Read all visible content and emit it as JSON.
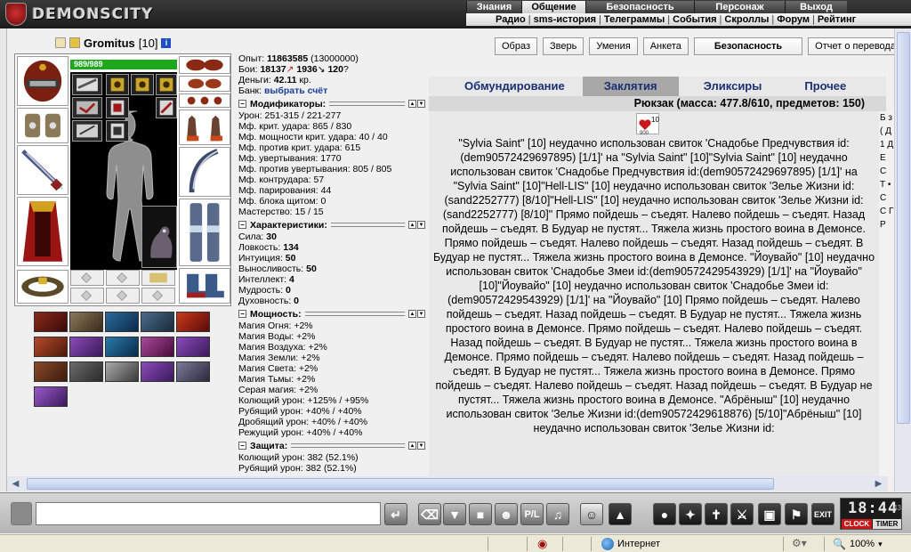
{
  "app": {
    "logo_text": "DEMONSCITY"
  },
  "top_menu": {
    "primary": [
      {
        "label": "Знания",
        "w": 62,
        "active": false
      },
      {
        "label": "Общение",
        "w": 72,
        "active": true
      },
      {
        "label": "Безопасность",
        "w": 122,
        "active": false
      },
      {
        "label": "Персонаж",
        "w": 102,
        "active": false
      },
      {
        "label": "Выход",
        "w": 70,
        "active": false
      }
    ],
    "secondary": [
      "Радио",
      "sms-история",
      "Телеграммы",
      "События",
      "Скроллы",
      "Форум",
      "Рейтинг"
    ]
  },
  "character": {
    "nickname": "Gromitus",
    "level": "[10]",
    "info_icon": "i",
    "hp": "989/989"
  },
  "stats": {
    "exp_label": "Опыт:",
    "exp_value": "11863585",
    "exp_next": "(13000000)",
    "battles_label": "Бои:",
    "battles_won": "18137",
    "battles_lost": "1936",
    "battles_draw": "120",
    "money_label": "Деньги:",
    "money_value": "42.11",
    "money_unit": "кр.",
    "bank_label": "Банк:",
    "bank_link": "выбрать счёт"
  },
  "sections": {
    "modifiers": {
      "title": "Модификаторы:",
      "rows": [
        "Урон: 251-315 / 221-277",
        "Мф. крит. удара: 865 / 830",
        "Мф. мощности крит. удара: 40 / 40",
        "Мф. против крит. удара: 615",
        "Мф. увертывания: 1770",
        "Мф. против увертывания: 805 / 805",
        "Мф. контрудара: 57",
        "Мф. парирования: 44",
        "Мф. блока щитом: 0",
        "Мастерство: 15 / 15"
      ]
    },
    "characteristics": {
      "title": "Характеристики:",
      "rows": [
        {
          "label": "Сила:",
          "value": "30"
        },
        {
          "label": "Ловкость:",
          "value": "134"
        },
        {
          "label": "Интуиция:",
          "value": "50"
        },
        {
          "label": "Выносливость:",
          "value": "50"
        },
        {
          "label": "Интеллект:",
          "value": "4"
        },
        {
          "label": "Мудрость:",
          "value": "0"
        },
        {
          "label": "Духовность:",
          "value": "0"
        }
      ]
    },
    "power": {
      "title": "Мощность:",
      "rows": [
        "Магия Огня: +2%",
        "Магия Воды: +2%",
        "Магия Воздуха: +2%",
        "Магия Земли: +2%",
        "Магия Света: +2%",
        "Магия Тьмы: +2%",
        "Серая магия: +2%",
        "Колющий урон: +125% / +95%",
        "Рубящий урон: +40% / +40%",
        "Дробящий урон: +40% / +40%",
        "Режущий урон: +40% / +40%"
      ]
    },
    "defense": {
      "title": "Защита:",
      "rows": [
        "Колющий урон: 382 (52.1%)",
        "Рубящий урон: 382 (52.1%)"
      ]
    }
  },
  "profile_buttons": [
    "Образ",
    "Зверь",
    "Умения",
    "Анкета",
    "Безопасность",
    "Отчет о переводах"
  ],
  "inventory": {
    "tabs": [
      {
        "label": "Обмундирование",
        "active": false
      },
      {
        "label": "Заклятия",
        "active": true
      },
      {
        "label": "Эликсиры",
        "active": false
      },
      {
        "label": "Прочее",
        "active": false
      }
    ],
    "backpack": "Рюкзак (масса: 477.8/610, предметов: 150)",
    "scroll_count": "10",
    "scroll_sub": "900",
    "log": "\"Sylvia Saint\" [10] неудачно использован свиток 'Снадобье Предчувствия id:(dem90572429697895) [1/1]' на \"Sylvia Saint\" [10]\"Sylvia Saint\" [10] неудачно использован свиток 'Снадобье Предчувствия id:(dem90572429697895) [1/1]' на \"Sylvia Saint\" [10]\"Hell-LIS\" [10] неудачно использован свиток 'Зелье Жизни id:(sand2252777) [8/10]\"Hell-LIS\" [10] неудачно использован свиток 'Зелье Жизни id:(sand2252777) [8/10]\" Прямо пойдешь – съедят. Налево пойдешь – съедят. Назад пойдешь – съедят. В Будуар не пустят... Тяжела жизнь простого воина в Демонсе. Прямо пойдешь – съедят. Налево пойдешь – съедят. Назад пойдешь – съедят. В Будуар не пустят... Тяжела жизнь простого воина в Демонсе. \"Йоувайо\" [10] неудачно использован свиток 'Снадобье Змеи id:(dem90572429543929) [1/1]' на \"Йоувайо\" [10]\"Йоувайо\" [10] неудачно использован свиток 'Снадобье Змеи id:(dem90572429543929) [1/1]' на \"Йоувайо\" [10] Прямо пойдешь – съедят. Налево пойдешь – съедят. Назад пойдешь – съедят. В Будуар не пустят... Тяжела жизнь простого воина в Демонсе. Прямо пойдешь – съедят. Налево пойдешь – съедят. Назад пойдешь – съедят. В Будуар не пустят... Тяжела жизнь простого воина в Демонсе. Прямо пойдешь – съедят. Налево пойдешь – съедят. Назад пойдешь – съедят. В Будуар не пустят... Тяжела жизнь простого воина в Демонсе. Прямо пойдешь – съедят. Налево пойдешь – съедят. Назад пойдешь – съедят. В Будуар не пустят... Тяжела жизнь простого воина в Демонсе. \"Абрёныш\" [10] неудачно использован свиток 'Зелье Жизни id:(dem90572429618876) [5/10]\"Абрёныш\" [10] неудачно использован свиток 'Зелье Жизни id:",
    "side_letters": "Б з ( Д 1 Д Е С Т • С С Г Р"
  },
  "bottom": {
    "clock_time": "18:44",
    "clock_sec": "43",
    "clock_label": "CLOCK",
    "timer_label": "TIMER"
  },
  "statusbar": {
    "zone": "Интернет",
    "zoom": "100%"
  },
  "colors": {
    "accent_blue": "#1a2f74",
    "hp_green": "#1ea81e",
    "clock_red": "#c81818"
  }
}
